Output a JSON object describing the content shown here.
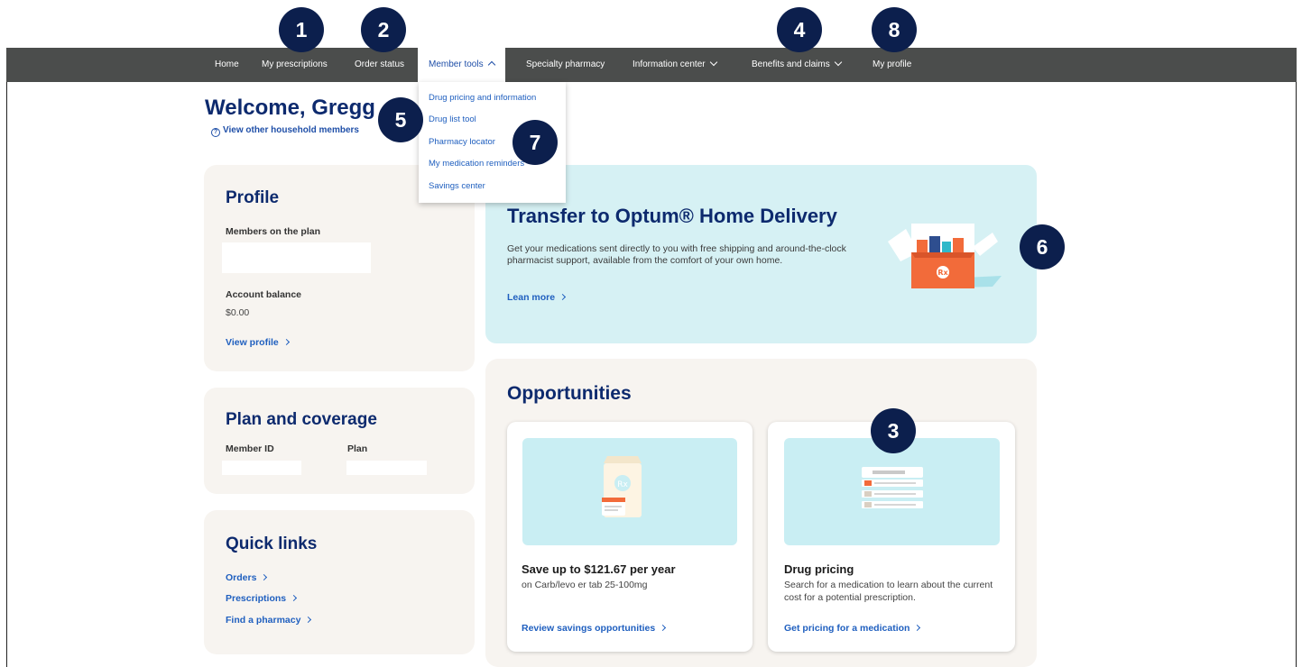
{
  "nav": {
    "home": "Home",
    "my_prescriptions": "My prescriptions",
    "order_status": "Order status",
    "member_tools": "Member tools",
    "specialty_pharmacy": "Specialty pharmacy",
    "information_center": "Information center",
    "benefits_and_claims": "Benefits and claims",
    "my_profile": "My profile"
  },
  "dropdown": {
    "items": [
      "Drug pricing and information",
      "Drug list tool",
      "Pharmacy locator",
      "My medication reminders",
      "Savings center"
    ]
  },
  "badges": [
    "1",
    "2",
    "3",
    "4",
    "5",
    "6",
    "7",
    "8"
  ],
  "welcome": {
    "title": "Welcome, Gregg",
    "household_link": "View other household members"
  },
  "profile": {
    "title": "Profile",
    "members_label": "Members on the plan",
    "account_balance_label": "Account balance",
    "account_balance_value": "$0.00",
    "view_profile": "View profile"
  },
  "plan": {
    "title": "Plan and coverage",
    "member_id_label": "Member ID",
    "plan_label": "Plan"
  },
  "quick_links": {
    "title": "Quick links",
    "orders": "Orders",
    "prescriptions": "Prescriptions",
    "find_pharmacy": "Find a pharmacy"
  },
  "banner": {
    "title": "Transfer to Optum® Home Delivery",
    "text": "Get your medications sent directly to you with free shipping and around-the-clock pharmacist support, available from the comfort of your own home.",
    "link": "Lean more"
  },
  "opportunities": {
    "title": "Opportunities",
    "savings": {
      "title": "Save up to $121.67 per year",
      "subtitle": "on Carb/levo er tab 25-100mg",
      "link": "Review savings opportunities"
    },
    "pricing": {
      "title": "Drug pricing",
      "subtitle": "Search for a medication to learn about the current cost for a potential prescription.",
      "link": "Get pricing for a medication"
    }
  },
  "colors": {
    "navbar": "#4b4d4c",
    "brand_navy": "#0d2a6e",
    "link_blue": "#1f5fbf",
    "card_bg": "#f7f4f0",
    "banner_bg": "#d6f1f4",
    "badge_bg": "#0c1f4d",
    "accent_orange": "#f26b3a"
  }
}
